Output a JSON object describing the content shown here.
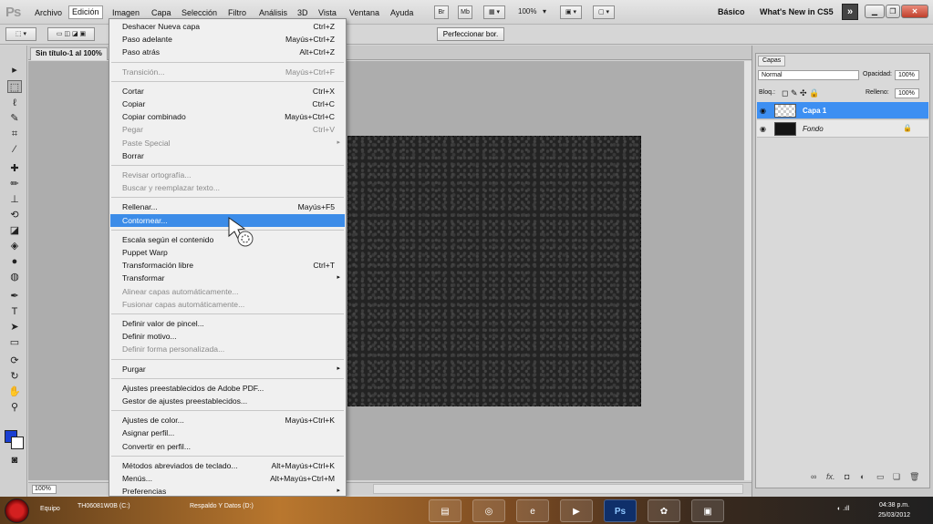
{
  "menubar": {
    "logo": "Ps",
    "items": [
      "Archivo",
      "Edición",
      "Imagen",
      "Capa",
      "Selección",
      "Filtro",
      "Análisis",
      "3D",
      "Vista",
      "Ventana",
      "Ayuda"
    ],
    "br": "Br",
    "mb": "Mb",
    "zoom": "100%",
    "workspaces": [
      "Básico",
      "What's New in CS5"
    ],
    "more": "»"
  },
  "options": {
    "refine": "Perfeccionar bor."
  },
  "document": {
    "tab": "Sin título-1 al 100%",
    "zoom": "100%"
  },
  "edit_menu": [
    {
      "label": "Deshacer Nueva capa",
      "shortcut": "Ctrl+Z"
    },
    {
      "label": "Paso adelante",
      "shortcut": "Mayús+Ctrl+Z"
    },
    {
      "label": "Paso atrás",
      "shortcut": "Alt+Ctrl+Z"
    },
    {
      "sep": true
    },
    {
      "label": "Transición...",
      "shortcut": "Mayús+Ctrl+F",
      "disabled": true
    },
    {
      "sep": true
    },
    {
      "label": "Cortar",
      "shortcut": "Ctrl+X"
    },
    {
      "label": "Copiar",
      "shortcut": "Ctrl+C"
    },
    {
      "label": "Copiar combinado",
      "shortcut": "Mayús+Ctrl+C"
    },
    {
      "label": "Pegar",
      "shortcut": "Ctrl+V",
      "disabled": true
    },
    {
      "label": "Paste Special",
      "submenu": true,
      "disabled": true
    },
    {
      "label": "Borrar"
    },
    {
      "sep": true
    },
    {
      "label": "Revisar ortografía...",
      "disabled": true
    },
    {
      "label": "Buscar y reemplazar texto...",
      "disabled": true
    },
    {
      "sep": true
    },
    {
      "label": "Rellenar...",
      "shortcut": "Mayús+F5"
    },
    {
      "label": "Contornear...",
      "highlighted": true
    },
    {
      "sep": true
    },
    {
      "label": "Escala según el contenido"
    },
    {
      "label": "Puppet Warp"
    },
    {
      "label": "Transformación libre",
      "shortcut": "Ctrl+T"
    },
    {
      "label": "Transformar",
      "submenu": true
    },
    {
      "label": "Alinear capas automáticamente...",
      "disabled": true
    },
    {
      "label": "Fusionar capas automáticamente...",
      "disabled": true
    },
    {
      "sep": true
    },
    {
      "label": "Definir valor de pincel..."
    },
    {
      "label": "Definir motivo..."
    },
    {
      "label": "Definir forma personalizada...",
      "disabled": true
    },
    {
      "sep": true
    },
    {
      "label": "Purgar",
      "submenu": true
    },
    {
      "sep": true
    },
    {
      "label": "Ajustes preestablecidos de Adobe PDF..."
    },
    {
      "label": "Gestor de ajustes preestablecidos..."
    },
    {
      "sep": true
    },
    {
      "label": "Ajustes de color...",
      "shortcut": "Mayús+Ctrl+K"
    },
    {
      "label": "Asignar perfil..."
    },
    {
      "label": "Convertir en perfil..."
    },
    {
      "sep": true
    },
    {
      "label": "Métodos abreviados de teclado...",
      "shortcut": "Alt+Mayús+Ctrl+K"
    },
    {
      "label": "Menús...",
      "shortcut": "Alt+Mayús+Ctrl+M"
    },
    {
      "label": "Preferencias",
      "submenu": true
    }
  ],
  "layers_panel": {
    "tab": "Capas",
    "blend_mode": "Normal",
    "opacity_label": "Opacidad:",
    "opacity": "100%",
    "lock_label": "Bloq.:",
    "fill_label": "Relleno:",
    "fill": "100%",
    "layers": [
      {
        "name": "Capa 1",
        "selected": true
      },
      {
        "name": "Fondo",
        "locked": true
      }
    ]
  },
  "taskbar": {
    "items": [
      "Equipo",
      "TH06081W0B (C:)",
      "Respaldo Y Datos (D:)"
    ],
    "ps": "Ps",
    "time": "04:38 p.m.",
    "date": "25/03/2012"
  }
}
